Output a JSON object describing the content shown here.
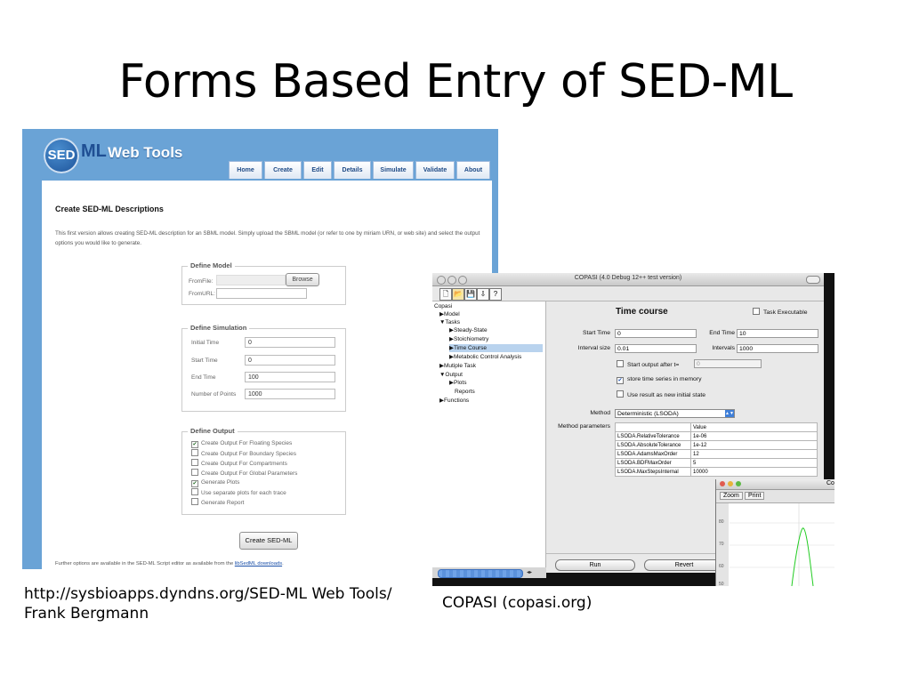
{
  "slide": {
    "title": "Forms Based Entry of SED-ML",
    "caption_left_line1": "http://sysbioapps.dyndns.org/SED-ML Web Tools/",
    "caption_left_line2": "Frank Bergmann",
    "caption_right": "COPASI (copasi.org)"
  },
  "sedml": {
    "logo_sed": "SED",
    "logo_ml": "ML",
    "logo_web": "Web Tools",
    "tabs": [
      "Home",
      "Create",
      "Edit",
      "Details",
      "Simulate",
      "Validate",
      "About"
    ],
    "heading": "Create SED-ML Descriptions",
    "intro": "This first version allows creating SED-ML description for an SBML model. Simply upload the SBML model (or refer to one by miriam URN, or web site) and select the output options you would like to generate.",
    "define_model": {
      "legend": "Define Model",
      "from_file_label": "FromFile:",
      "browse_label": "Browse",
      "from_url_label": "FromURL:"
    },
    "define_simulation": {
      "legend": "Define Simulation",
      "fields": [
        {
          "label": "Initial Time",
          "value": "0"
        },
        {
          "label": "Start Time",
          "value": "0"
        },
        {
          "label": "End Time",
          "value": "100"
        },
        {
          "label": "Number of Points",
          "value": "1000"
        }
      ]
    },
    "define_output": {
      "legend": "Define Output",
      "options": [
        {
          "label": "Create Output For Floating Species",
          "checked": true
        },
        {
          "label": "Create Output For Boundary Species",
          "checked": false
        },
        {
          "label": "Create Output For Compartments",
          "checked": false
        },
        {
          "label": "Create Output For Global Parameters",
          "checked": false
        },
        {
          "label": "Generate Plots",
          "checked": true
        },
        {
          "label": "Use separate plots for each trace",
          "checked": false
        },
        {
          "label": "Generate Report",
          "checked": false
        }
      ]
    },
    "create_button": "Create SED-ML",
    "footer_text": "Further options are available in the SED-ML Script editor as available from the ",
    "footer_link": "libSedML downloads",
    "footer_end": "."
  },
  "copasi": {
    "window_title": "COPASI (4.0 Debug 12++ test version)",
    "tree": [
      {
        "label": "Copasi",
        "indent": 0,
        "selected": false
      },
      {
        "label": "▶Model",
        "indent": 1,
        "selected": false
      },
      {
        "label": "▼Tasks",
        "indent": 1,
        "selected": false
      },
      {
        "label": "▶Steady-State",
        "indent": 2,
        "selected": false
      },
      {
        "label": "▶Stoichiometry",
        "indent": 2,
        "selected": false
      },
      {
        "label": "▶Time Course",
        "indent": 2,
        "selected": true
      },
      {
        "label": "▶Metabolic Control Analysis",
        "indent": 2,
        "selected": false
      },
      {
        "label": "▶Mutiple Task",
        "indent": 1,
        "selected": false
      },
      {
        "label": "▼Output",
        "indent": 1,
        "selected": false
      },
      {
        "label": "▶Plots",
        "indent": 2,
        "selected": false
      },
      {
        "label": "Reports",
        "indent": 2,
        "selected": false
      },
      {
        "label": "▶Functions",
        "indent": 1,
        "selected": false
      }
    ],
    "panel_title": "Time course",
    "task_executable": "Task Executable",
    "start_time_label": "Start Time",
    "start_time": "0",
    "end_time_label": "End Time",
    "end_time": "10",
    "interval_size_label": "Interval size",
    "interval_size": "0.01",
    "intervals_label": "Intervals",
    "intervals": "1000",
    "start_output_label": "Start output after t=",
    "start_output_value": "0",
    "store_time_series": "store time series in memory",
    "use_result": "Use result as new initial state",
    "method_label": "Method",
    "method_value": "Deterministic (LSODA)",
    "method_params_label": "Method parameters",
    "params_header": "Value",
    "params": [
      {
        "name": "LSODA.RelativeTolerance",
        "value": "1e-06"
      },
      {
        "name": "LSODA.AbsoluteTolerance",
        "value": "1e-12"
      },
      {
        "name": "LSODA.AdamsMaxOrder",
        "value": "12"
      },
      {
        "name": "LSODA.BDFMaxOrder",
        "value": "5"
      },
      {
        "name": "LSODA.MaxStepsInternal",
        "value": "10000"
      }
    ],
    "run_label": "Run",
    "revert_label": "Revert",
    "plot_title_fragment": "Co",
    "plot_zoom": "Zoom",
    "plot_print": "Print",
    "plot_ticks": [
      "80",
      "70",
      "60",
      "50"
    ]
  },
  "colors": {
    "sedml_bg": "#6aa3d6",
    "tab_text": "#1e4a86",
    "copasi_selection": "#b9d3ee",
    "plot_curve": "#22cc22"
  }
}
